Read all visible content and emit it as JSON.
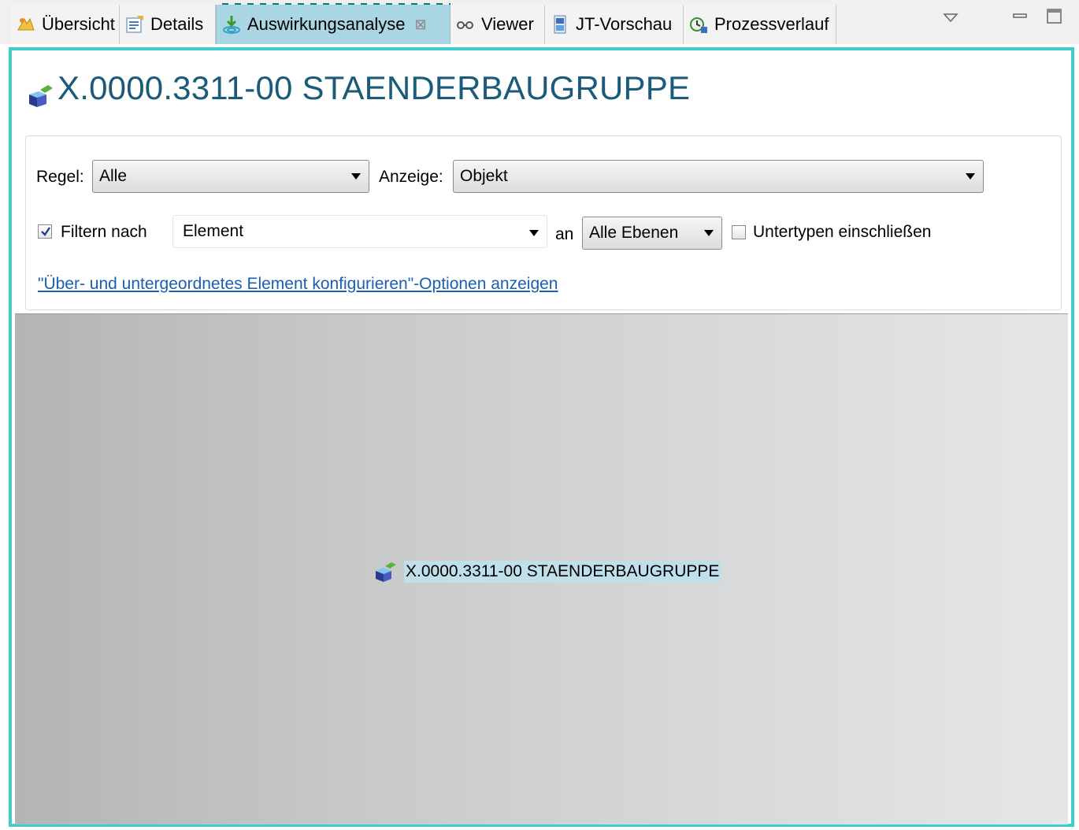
{
  "tabs": [
    {
      "label": "Übersicht",
      "icon": "overview-icon"
    },
    {
      "label": "Details",
      "icon": "details-icon"
    },
    {
      "label": "Auswirkungsanalyse",
      "icon": "impact-analysis-icon",
      "active": true,
      "close": "⊠"
    },
    {
      "label": "Viewer",
      "icon": "glasses-icon"
    },
    {
      "label": "JT-Vorschau",
      "icon": "jt-preview-icon"
    },
    {
      "label": "Prozessverlauf",
      "icon": "process-history-icon"
    }
  ],
  "window_controls": {
    "menu": "view-menu-icon",
    "minimize": "minimize-icon",
    "maximize": "maximize-icon"
  },
  "header": {
    "title": "X.0000.3311-00 STAENDERBAUGRUPPE",
    "icon": "assembly-icon"
  },
  "filters": {
    "rule_label": "Regel:",
    "rule_value": "Alle",
    "display_label": "Anzeige:",
    "display_value": "Objekt",
    "filter_label": "Filtern nach",
    "filter_checked": true,
    "filter_value": "Element",
    "at_label": "an",
    "level_value": "Alle Ebenen",
    "subtypes_label": "Untertypen einschließen",
    "subtypes_checked": false,
    "configure_link": "\"Über- und untergeordnetes Element konfigurieren\"-Optionen anzeigen"
  },
  "graph": {
    "node_label": "X.0000.3311-00 STAENDERBAUGRUPPE",
    "node_icon": "assembly-icon"
  },
  "colors": {
    "accent": "#3fcdc9",
    "active_tab": "#a9d6e2",
    "title": "#1a5a7a",
    "link": "#1a5fb4"
  }
}
